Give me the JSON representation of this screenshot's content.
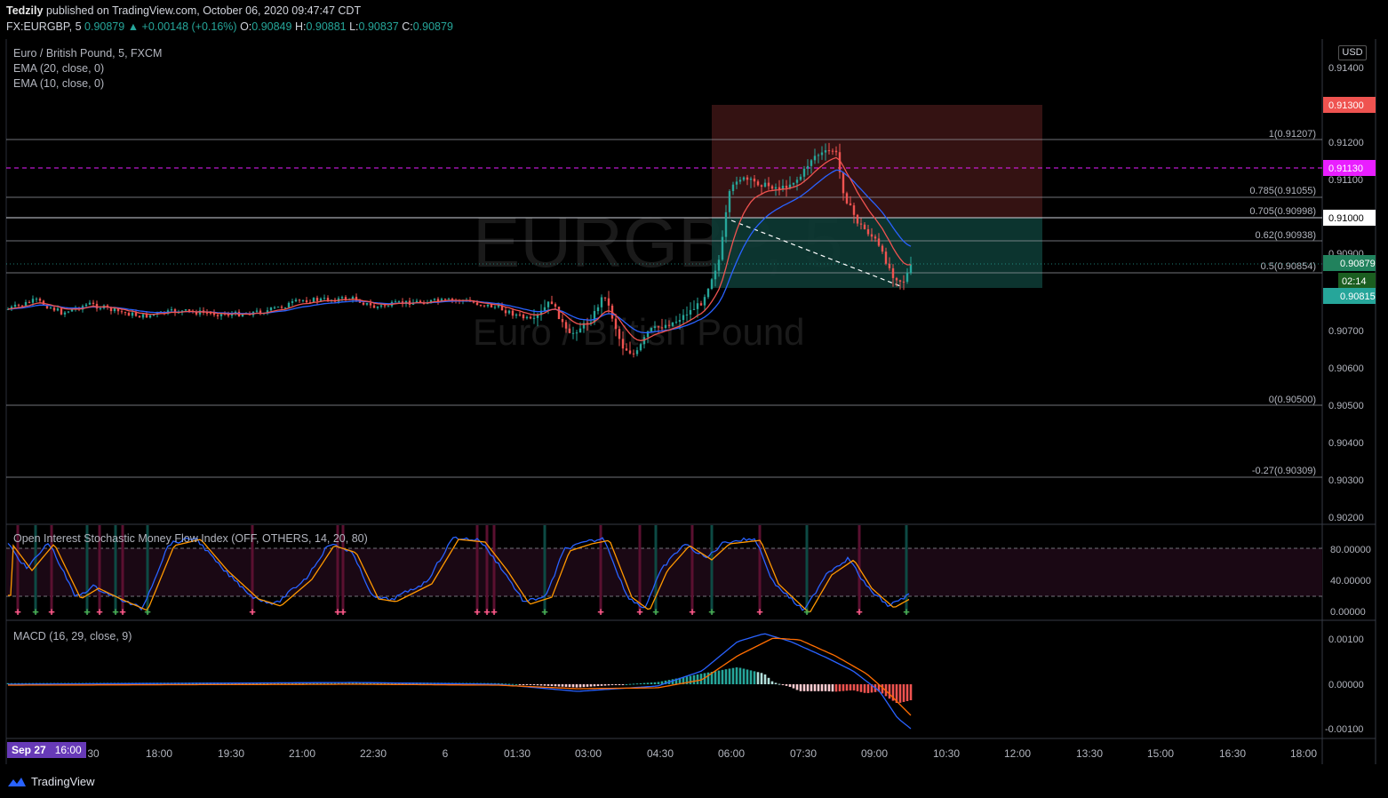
{
  "header": {
    "publisher": "Tedzily",
    "published_text": "published on TradingView.com, October 06, 2020 09:47:47 CDT",
    "symbol": "FX:EURGBP, 5",
    "last": "0.90879",
    "change": "+0.00148 (+0.16%)",
    "open_label": "O:",
    "open": "0.90849",
    "high_label": "H:",
    "high": "0.90881",
    "low_label": "L:",
    "low": "0.90837",
    "close_label": "C:",
    "close": "0.90879"
  },
  "main_pane": {
    "series_title": "Euro / British Pound, 5, FXCM",
    "ema20_label": "EMA (20, close, 0)",
    "ema10_label": "EMA (10, close, 0)",
    "watermark_symbol": "EURGBP, 5",
    "watermark_name": "Euro / British Pound",
    "currency_button": "USD",
    "price_ticks": [
      "0.91400",
      "0.91200",
      "0.91100",
      "0.90900",
      "0.90700",
      "0.90600",
      "0.90500",
      "0.90400",
      "0.90300",
      "0.90200"
    ],
    "price_badges": {
      "target": "0.91300",
      "magenta_line": "0.91130",
      "level": "0.91000",
      "last_price": "0.90879",
      "countdown": "02:14",
      "stop": "0.90815"
    },
    "fib_levels": [
      "1(0.91207)",
      "0.785(0.91055)",
      "0.705(0.90998)",
      "0.62(0.90938)",
      "0.5(0.90854)",
      "0(0.90500)",
      "-0.27(0.90309)"
    ]
  },
  "stoch_pane": {
    "title": "Open Interest Stochastic Money Flow Index (OFF, OTHERS, 14, 20, 80)",
    "ticks": [
      "80.00000",
      "40.00000",
      "0.00000"
    ]
  },
  "macd_pane": {
    "title": "MACD (16, 29, close, 9)",
    "ticks": [
      "0.00100",
      "0.00000",
      "-0.00100"
    ]
  },
  "time_axis": {
    "badge_date": "Sep 27",
    "badge_time": "16:00",
    "ticks": [
      "30",
      "18:00",
      "19:30",
      "21:00",
      "22:30",
      "6",
      "01:30",
      "03:00",
      "04:30",
      "06:00",
      "07:30",
      "09:00",
      "10:30",
      "12:00",
      "13:30",
      "15:00",
      "16:30",
      "18:00"
    ]
  },
  "footer": {
    "brand": "TradingView"
  },
  "colors": {
    "up": "#26a69a",
    "down": "#ef5350",
    "ema20": "#2962ff",
    "ema10": "#ef5350",
    "magenta": "#e91eff",
    "target_zone": "#3a1414",
    "stop_zone": "#0d3a34"
  }
}
